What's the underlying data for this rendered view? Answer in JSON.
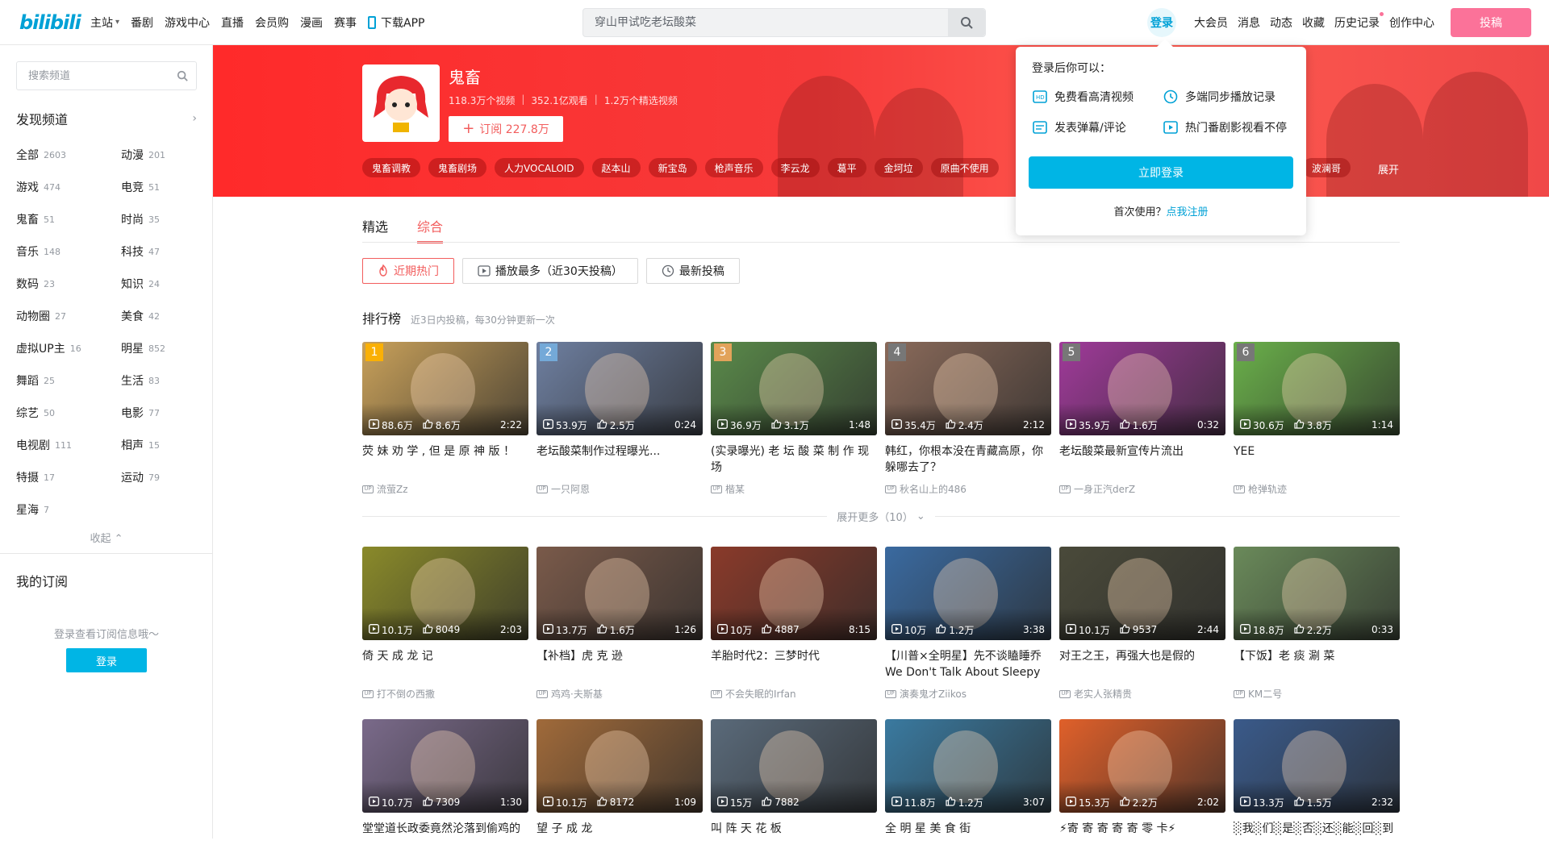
{
  "header": {
    "logo": "bilibili",
    "nav": [
      {
        "label": "主站",
        "has_arrow": true
      },
      {
        "label": "番剧"
      },
      {
        "label": "游戏中心"
      },
      {
        "label": "直播"
      },
      {
        "label": "会员购"
      },
      {
        "label": "漫画"
      },
      {
        "label": "赛事"
      },
      {
        "label": "下载APP"
      }
    ],
    "search_placeholder": "穿山甲试吃老坛酸菜",
    "login": "登录",
    "right_nav": [
      "大会员",
      "消息",
      "动态",
      "收藏",
      "历史记录",
      "创作中心"
    ],
    "upload": "投稿"
  },
  "sidebar": {
    "search_placeholder": "搜索频道",
    "discover": "发现频道",
    "categories": [
      {
        "name": "全部",
        "count": "2603"
      },
      {
        "name": "动漫",
        "count": "201"
      },
      {
        "name": "游戏",
        "count": "474"
      },
      {
        "name": "电竞",
        "count": "51"
      },
      {
        "name": "鬼畜",
        "count": "51"
      },
      {
        "name": "时尚",
        "count": "35"
      },
      {
        "name": "音乐",
        "count": "148"
      },
      {
        "name": "科技",
        "count": "47"
      },
      {
        "name": "数码",
        "count": "23"
      },
      {
        "name": "知识",
        "count": "24"
      },
      {
        "name": "动物圈",
        "count": "27"
      },
      {
        "name": "美食",
        "count": "42"
      },
      {
        "name": "虚拟UP主",
        "count": "16"
      },
      {
        "name": "明星",
        "count": "852"
      },
      {
        "name": "舞蹈",
        "count": "25"
      },
      {
        "name": "生活",
        "count": "83"
      },
      {
        "name": "综艺",
        "count": "50"
      },
      {
        "name": "电影",
        "count": "77"
      },
      {
        "name": "电视剧",
        "count": "111"
      },
      {
        "name": "相声",
        "count": "15"
      },
      {
        "name": "特摄",
        "count": "17"
      },
      {
        "name": "运动",
        "count": "79"
      },
      {
        "name": "星海",
        "count": "7"
      }
    ],
    "collapse": "收起",
    "my_subscriptions": "我的订阅",
    "sub_tip": "登录查看订阅信息哦～",
    "login_button": "登录"
  },
  "channel": {
    "name": "鬼畜",
    "stats": [
      "118.3万个视频",
      "352.1亿观看",
      "1.2万个精选视频"
    ],
    "subscribe": "订阅 227.8万",
    "tags": [
      "鬼畜调教",
      "鬼畜剧场",
      "人力VOCALOID",
      "赵本山",
      "新宝岛",
      "枪声音乐",
      "李云龙",
      "葛平",
      "金坷垃",
      "原曲不使用"
    ],
    "tag_right": "波澜哥",
    "expand": "展开"
  },
  "login_popover": {
    "heading": "登录后你可以：",
    "features": [
      "免费看高清视频",
      "多端同步播放记录",
      "发表弹幕/评论",
      "热门番剧影视看不停"
    ],
    "login_button": "立即登录",
    "first_use": "首次使用？",
    "register": "点我注册"
  },
  "tabs": [
    {
      "label": "精选",
      "active": false
    },
    {
      "label": "综合",
      "active": true
    }
  ],
  "filters": [
    {
      "label": "近期热门",
      "icon": "flame-icon",
      "active": true
    },
    {
      "label": "播放最多（近30天投稿）",
      "icon": "play-icon",
      "active": false
    },
    {
      "label": "最新投稿",
      "icon": "clock-icon",
      "active": false
    }
  ],
  "ranking": {
    "title": "排行榜",
    "subtitle": "近3日内投稿，每30分钟更新一次",
    "expand_more": "展开更多（10）",
    "videos": [
      {
        "rank": "1",
        "views": "88.6万",
        "likes": "8.6万",
        "duration": "2:22",
        "title": "荧 妹 劝 学 , 但 是 原 神 版 ！",
        "up": "流萤Zz",
        "color": "#c9a15a",
        "rank_color": "#fab005"
      },
      {
        "rank": "2",
        "views": "53.9万",
        "likes": "2.5万",
        "duration": "0:24",
        "title": "老坛酸菜制作过程曝光...",
        "up": "一只阿恩",
        "color": "#6e7fa0",
        "rank_color": "#74a9d8"
      },
      {
        "rank": "3",
        "views": "36.9万",
        "likes": "3.1万",
        "duration": "1:48",
        "title": "(实录曝光) 老 坛 酸 菜 制 作 现 场",
        "up": "楷某",
        "color": "#5a8a4a",
        "rank_color": "#e2a35a"
      },
      {
        "rank": "4",
        "views": "35.4万",
        "likes": "2.4万",
        "duration": "2:12",
        "title": "韩红，你根本没在青藏高原，你躲哪去了？",
        "up": "秋名山上的486",
        "color": "#8a6a5a",
        "rank_color": "#777777"
      },
      {
        "rank": "5",
        "views": "35.9万",
        "likes": "1.6万",
        "duration": "0:32",
        "title": "老坛酸菜最新宣传片流出",
        "up": "一身正汽derZ",
        "color": "#a03a9a",
        "rank_color": "#777777"
      },
      {
        "rank": "6",
        "views": "30.6万",
        "likes": "3.8万",
        "duration": "1:14",
        "title": "YEE",
        "up": "枪弹轨迹",
        "color": "#6ab04a",
        "rank_color": "#777777"
      }
    ]
  },
  "grid": [
    [
      {
        "views": "10.1万",
        "likes": "8049",
        "duration": "2:03",
        "title": "倚 天 成 龙 记",
        "up": "打不倒の西撒",
        "color": "#8a8a2a"
      },
      {
        "views": "13.7万",
        "likes": "1.6万",
        "duration": "1:26",
        "title": "【补档】虎 克 逊",
        "up": "鸡鸡·夫斯基",
        "color": "#7a5a4a"
      },
      {
        "views": "10万",
        "likes": "4887",
        "duration": "8:15",
        "title": "羊胎时代2：三梦时代",
        "up": "不会失眠的Irfan",
        "color": "#8a3a2a"
      },
      {
        "views": "10万",
        "likes": "1.2万",
        "duration": "3:38",
        "title": "【川普×全明星】先不谈瞌睡乔We Don't Talk About Sleepy Joe...",
        "up": "演奏鬼才Ziikos",
        "color": "#3a6aa0"
      },
      {
        "views": "10.1万",
        "likes": "9537",
        "duration": "2:44",
        "title": "对王之王，再强大也是假的",
        "up": "老实人张精贵",
        "color": "#4a4a3a"
      },
      {
        "views": "18.8万",
        "likes": "2.2万",
        "duration": "0:33",
        "title": "【下饭】老 痰 涮 菜",
        "up": "KM二号",
        "color": "#6a8a5a"
      }
    ],
    [
      {
        "views": "10.7万",
        "likes": "7309",
        "duration": "1:30",
        "title": "堂堂道长政委竟然沦落到偷鸡的",
        "up": "",
        "color": "#7a6a8a"
      },
      {
        "views": "10.1万",
        "likes": "8172",
        "duration": "1:09",
        "title": "望 子 成 龙",
        "up": "",
        "color": "#a06a3a"
      },
      {
        "views": "15万",
        "likes": "7882",
        "duration": "",
        "title": "叫 阵 天 花 板",
        "up": "",
        "color": "#5a6a7a"
      },
      {
        "views": "11.8万",
        "likes": "1.2万",
        "duration": "3:07",
        "title": "全 明 星 美 食 街",
        "up": "",
        "color": "#3a7aa0"
      },
      {
        "views": "15.3万",
        "likes": "2.2万",
        "duration": "2:02",
        "title": "⚡寄 寄 寄 寄 寄 零 卡⚡",
        "up": "",
        "color": "#e0602a"
      },
      {
        "views": "13.3万",
        "likes": "1.5万",
        "duration": "2:32",
        "title": "░我░们░是░否░还░能░回░到",
        "up": "",
        "color": "#3a5a8a"
      }
    ]
  ]
}
